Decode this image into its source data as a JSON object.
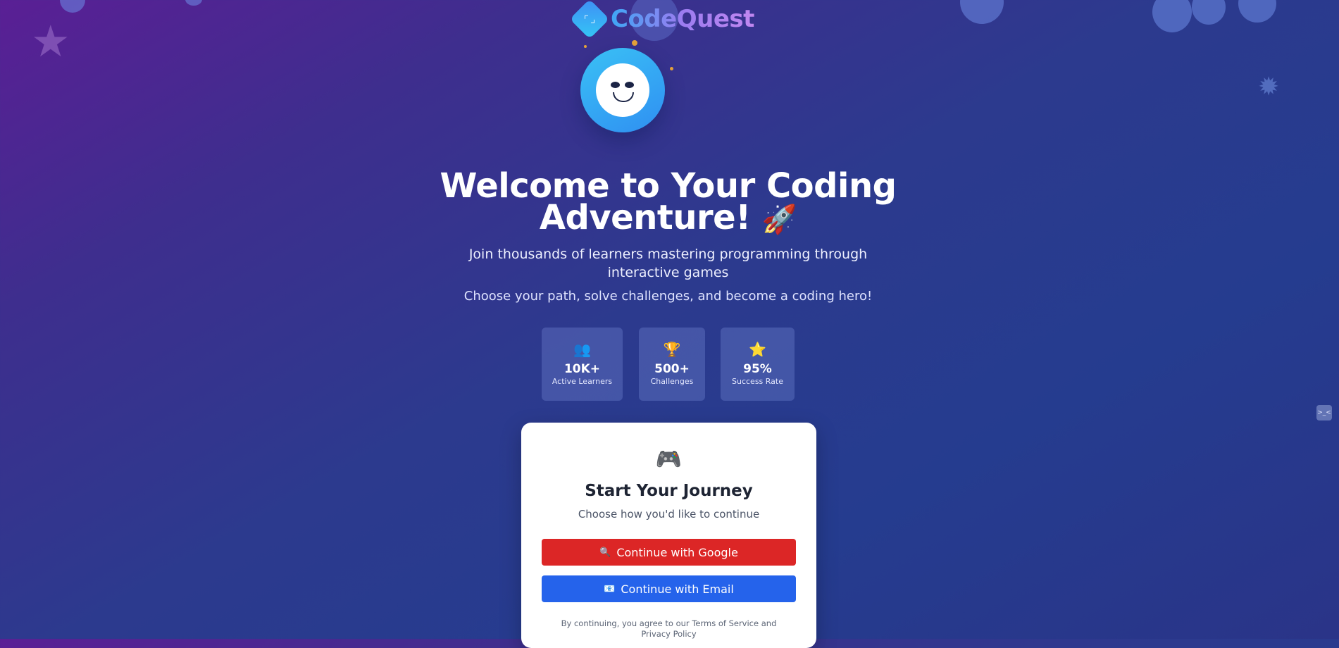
{
  "brand": {
    "name": "CodeQuest",
    "logo_icon": "code-bracket-icon",
    "logo_glyph": "⌜⌟"
  },
  "hero": {
    "title": "Welcome to Your Coding Adventure!",
    "title_emoji": "🚀",
    "subtitle": "Join thousands of learners mastering programming through interactive games",
    "tagline": "Choose your path, solve challenges, and become a coding hero!"
  },
  "stats": [
    {
      "icon": "👥",
      "icon_name": "users-icon",
      "value": "10K+",
      "label": "Active Learners"
    },
    {
      "icon": "🏆",
      "icon_name": "trophy-icon",
      "value": "500+",
      "label": "Challenges"
    },
    {
      "icon": "⭐",
      "icon_name": "star-icon",
      "value": "95%",
      "label": "Success Rate"
    }
  ],
  "card": {
    "icon": "🎮",
    "icon_name": "game-controller-icon",
    "title": "Start Your Journey",
    "subtitle": "Choose how you'd like to continue",
    "google_button": {
      "icon": "🔍",
      "label": "Continue with Google"
    },
    "email_button": {
      "icon": "📧",
      "label": "Continue with Email"
    },
    "terms": "By continuing, you agree to our Terms of Service and Privacy Policy"
  },
  "colors": {
    "background_start": "#5a1f95",
    "background_end": "#253c8f",
    "google_button": "#dc2626",
    "email_button": "#2563eb",
    "brand_gradient_start": "#3ea7f5",
    "brand_gradient_end": "#c187f0"
  }
}
